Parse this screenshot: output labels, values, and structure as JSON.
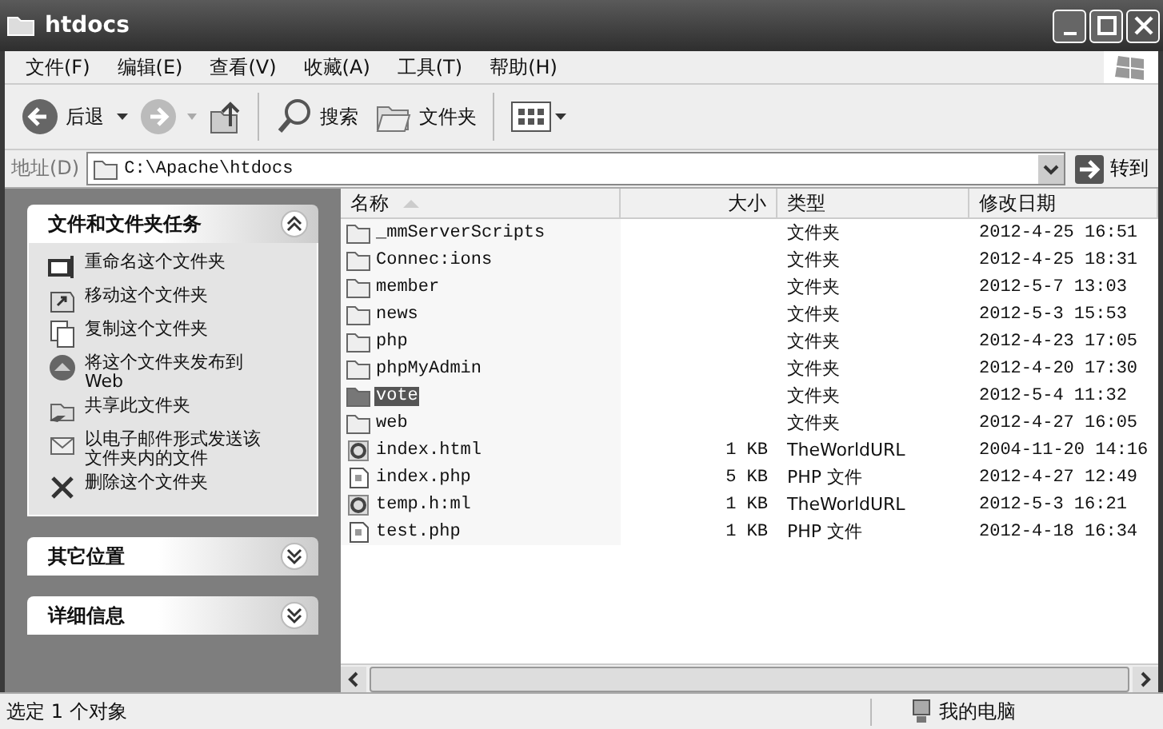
{
  "window": {
    "title": "htdocs"
  },
  "menu": [
    "文件(F)",
    "编辑(E)",
    "查看(V)",
    "收藏(A)",
    "工具(T)",
    "帮助(H)"
  ],
  "toolbar": {
    "back": "后退",
    "search": "搜索",
    "folders": "文件夹"
  },
  "address": {
    "label": "地址(D)",
    "value": "C:\\Apache\\htdocs",
    "go": "转到"
  },
  "panels": [
    {
      "title": "文件和文件夹任务",
      "expanded": true,
      "items": [
        {
          "kind": "rename",
          "label": "重命名这个文件夹"
        },
        {
          "kind": "move",
          "label": "移动这个文件夹"
        },
        {
          "kind": "copy",
          "label": "复制这个文件夹"
        },
        {
          "kind": "web",
          "label": "将这个文件夹发布到 Web"
        },
        {
          "kind": "share",
          "label": "共享此文件夹"
        },
        {
          "kind": "mail",
          "label": "以电子邮件形式发送该文件夹内的文件"
        },
        {
          "kind": "delete",
          "label": "删除这个文件夹"
        }
      ]
    },
    {
      "title": "其它位置",
      "expanded": false
    },
    {
      "title": "详细信息",
      "expanded": false
    }
  ],
  "table": {
    "columns": [
      "名称",
      "大小",
      "类型",
      "修改日期"
    ],
    "rows": [
      {
        "kind": "folder",
        "name": "_mmServerScripts",
        "type": "文件夹",
        "date": "2012-4-25 16:51",
        "selected": false
      },
      {
        "kind": "folder",
        "name": "Connec:ions",
        "type": "文件夹",
        "date": "2012-4-25 18:31",
        "selected": false
      },
      {
        "kind": "folder",
        "name": "member",
        "type": "文件夹",
        "date": "2012-5-7 13:03",
        "selected": false
      },
      {
        "kind": "folder",
        "name": "news",
        "type": "文件夹",
        "date": "2012-5-3 15:53",
        "selected": false
      },
      {
        "kind": "folder",
        "name": "php",
        "type": "文件夹",
        "date": "2012-4-23 17:05",
        "selected": false
      },
      {
        "kind": "folder",
        "name": "phpMyAdmin",
        "type": "文件夹",
        "date": "2012-4-20 17:30",
        "selected": false
      },
      {
        "kind": "folder",
        "name": "vote",
        "type": "文件夹",
        "date": "2012-5-4 11:32",
        "selected": true
      },
      {
        "kind": "folder",
        "name": "web",
        "type": "文件夹",
        "date": "2012-4-27 16:05",
        "selected": false
      },
      {
        "kind": "html",
        "name": "index.html",
        "size": "1 KB",
        "type": "TheWorldURL",
        "date": "2004-11-20 14:16",
        "selected": false
      },
      {
        "kind": "php",
        "name": "index.php",
        "size": "5 KB",
        "type": "PHP 文件",
        "date": "2012-4-27 12:49",
        "selected": false
      },
      {
        "kind": "html",
        "name": "temp.h:ml",
        "size": "1 KB",
        "type": "TheWorldURL",
        "date": "2012-5-3 16:21",
        "selected": false
      },
      {
        "kind": "php",
        "name": "test.php",
        "size": "1 KB",
        "type": "PHP 文件",
        "date": "2012-4-18 16:34",
        "selected": false
      }
    ]
  },
  "status_bar": {
    "text": "选定 1 个对象",
    "location": "我的电脑"
  }
}
